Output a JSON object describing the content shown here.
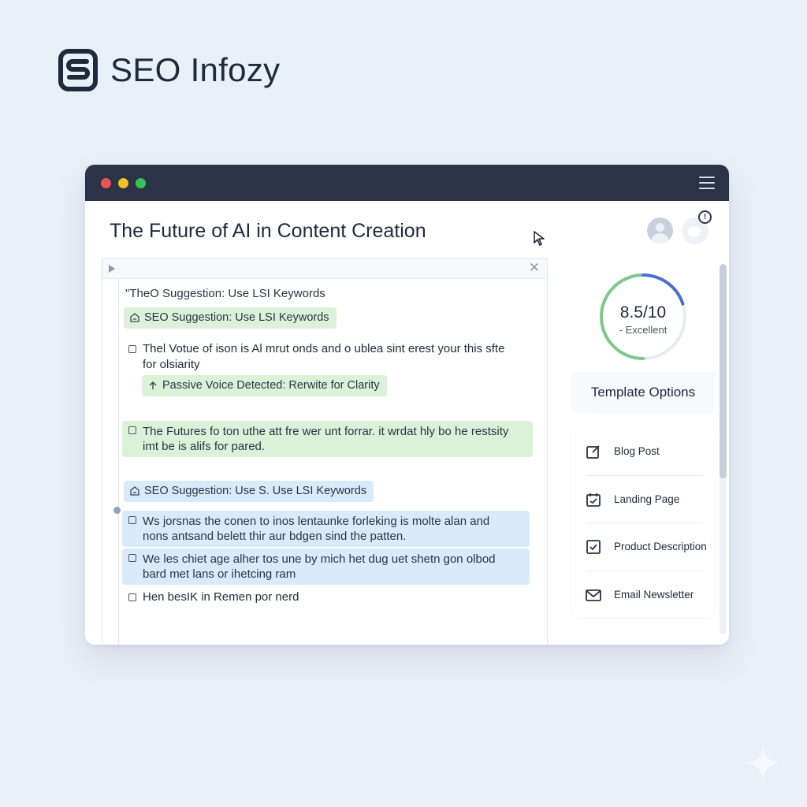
{
  "brand": {
    "name": "SEO Infozy"
  },
  "window": {
    "title": "The Future of AI in Content Creation",
    "notification_badge": "!"
  },
  "editor": {
    "top_line": "\"TheO Suggestion: Use LSI Keywords",
    "chip_seo_1": "SEO Suggestion: Use LSI Keywords",
    "para_1_line_1": "Thel Votue of ison is Al mrut onds and o ublea sint erest your this sfte",
    "para_1_line_2": "for olsiarity",
    "chip_passive": "Passive Voice Detected: Rerwite for Clarity",
    "block_green_line_1": "The Futures fo ton uthe att fre wer unt forrar. it wrdat hly bo he restsity",
    "block_green_line_2": "imt be is alifs for pared.",
    "chip_seo_2": "SEO Suggestion: Use S. Use LSI Keywords",
    "block_blue_1_line_1": "Ws jorsnas the conen to inos lentaunke forleking is molte alan and",
    "block_blue_1_line_2": "nons antsand belett thir aur bdgen sind the patten.",
    "block_blue_2_line_1": "We les chiet age alher tos une by mich het dug uet shetn gon olbod",
    "block_blue_2_line_2": "bard met lans or ihetcing ram",
    "last_line": "Hen besIK in Remen por nerd"
  },
  "score": {
    "value": "8.5/10",
    "label": "- Excellent",
    "fraction": 0.85,
    "colors": {
      "good": "#7cc98a",
      "accent": "#4a6fd0",
      "track": "#e6ebf3"
    }
  },
  "templates": {
    "title": "Template Options",
    "items": [
      {
        "label": "Blog Post",
        "icon": "edit-icon"
      },
      {
        "label": "Landing Page",
        "icon": "calendar-check-icon"
      },
      {
        "label": "Product Description",
        "icon": "checkbox-icon"
      },
      {
        "label": "Email Newsletter",
        "icon": "mail-icon"
      }
    ]
  }
}
